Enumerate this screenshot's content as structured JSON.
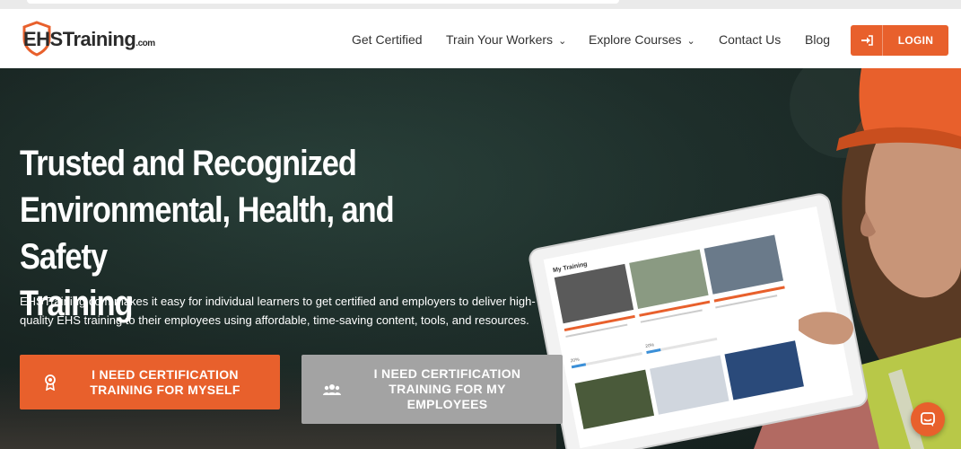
{
  "brand": {
    "logo_text": "EHSTraining",
    "logo_suffix": ".com"
  },
  "nav": {
    "items": [
      {
        "label": "Get Certified",
        "has_dropdown": false
      },
      {
        "label": "Train Your Workers",
        "has_dropdown": true
      },
      {
        "label": "Explore Courses",
        "has_dropdown": true
      },
      {
        "label": "Contact Us",
        "has_dropdown": false
      },
      {
        "label": "Blog",
        "has_dropdown": false
      }
    ],
    "login_label": "LOGIN"
  },
  "hero": {
    "title_line1": "Trusted and Recognized",
    "title_line2": "Environmental, Health, and Safety",
    "title_line3": "Training",
    "description": "EHSTraining.com makes it easy for individual learners to get certified and employers to deliver high-quality EHS training to their employees using affordable, time-saving content, tools, and resources.",
    "cta_primary": "I NEED CERTIFICATION TRAINING FOR MYSELF",
    "cta_secondary": "I NEED CERTIFICATION TRAINING FOR MY EMPLOYEES"
  },
  "tablet": {
    "header": "My Training",
    "progress_labels": [
      "20%",
      "20%"
    ]
  },
  "colors": {
    "accent": "#e8602c",
    "secondary_button": "#a3a3a3",
    "hero_dark": "#1f302c"
  },
  "icons": {
    "login": "sign-in-icon",
    "cta_primary": "award-icon",
    "cta_secondary": "users-icon",
    "chat": "chat-icon"
  }
}
